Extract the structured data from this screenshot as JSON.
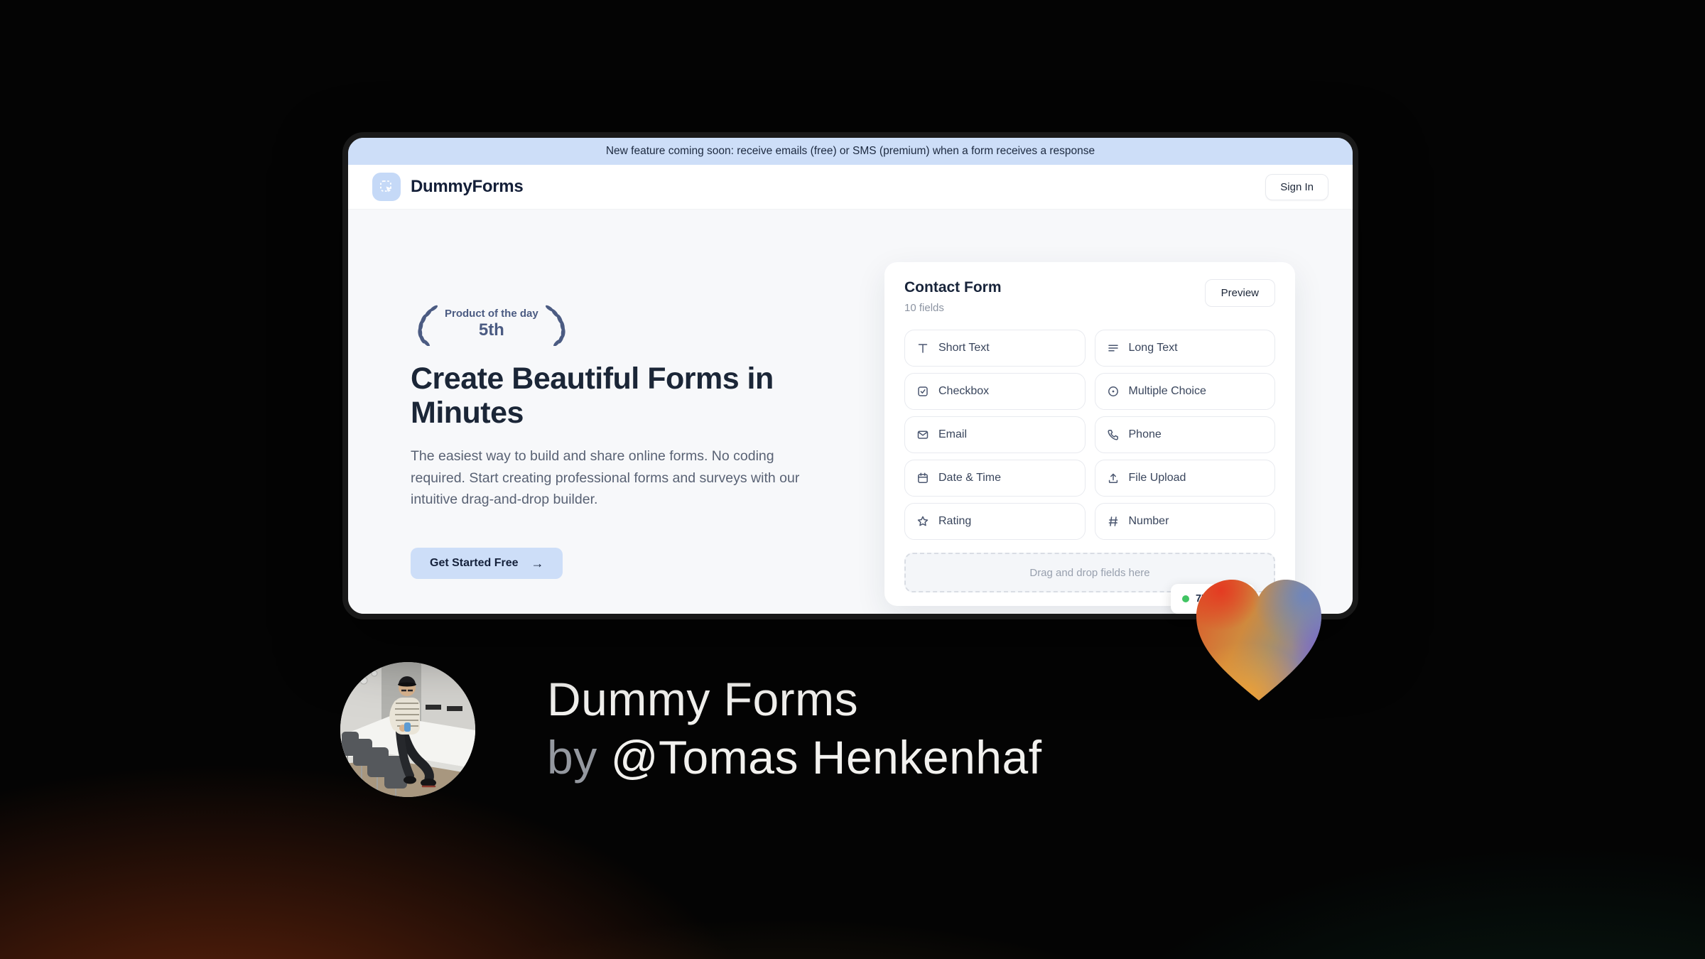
{
  "banner": {
    "text": "New feature coming soon: receive emails (free) or SMS (premium) when a form receives a response"
  },
  "header": {
    "brand": "DummyForms",
    "sign_in_label": "Sign In"
  },
  "badge": {
    "line1": "Product of the day",
    "line2": "5th"
  },
  "hero": {
    "heading": "Create Beautiful Forms in Minutes",
    "paragraph": "The easiest way to build and share online forms. No coding required. Start creating professional forms and surveys with our intuitive drag-and-drop builder.",
    "cta_label": "Get Started Free",
    "cta_arrow": "→"
  },
  "form_builder": {
    "title": "Contact Form",
    "subtitle": "10 fields",
    "preview_label": "Preview",
    "fields": [
      {
        "icon": "short-text-icon",
        "label": "Short Text"
      },
      {
        "icon": "long-text-icon",
        "label": "Long Text"
      },
      {
        "icon": "checkbox-icon",
        "label": "Checkbox"
      },
      {
        "icon": "multiple-choice-icon",
        "label": "Multiple Choice"
      },
      {
        "icon": "email-icon",
        "label": "Email"
      },
      {
        "icon": "phone-icon",
        "label": "Phone"
      },
      {
        "icon": "date-time-icon",
        "label": "Date & Time"
      },
      {
        "icon": "file-upload-icon",
        "label": "File Upload"
      },
      {
        "icon": "rating-icon",
        "label": "Rating"
      },
      {
        "icon": "number-icon",
        "label": "Number"
      }
    ],
    "dropzone_text": "Drag and drop fields here",
    "status_pill": {
      "text": "77"
    }
  },
  "attribution": {
    "title": "Dummy Forms",
    "byline_prefix": "by",
    "byline_handle": "@Tomas Henkenhaf"
  },
  "colors": {
    "accent_blue": "#cddef8",
    "logo_blue": "#c5d9f7",
    "brand_navy": "#141f38",
    "status_green": "#41c463",
    "heart_red": "#e43b22",
    "heart_orange": "#f1a134",
    "heart_blue": "#6e86bd",
    "heart_purple": "#7b64c6"
  }
}
